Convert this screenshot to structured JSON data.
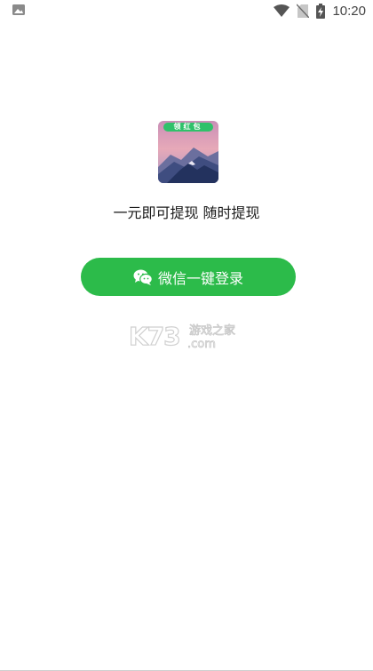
{
  "status_bar": {
    "time": "10:20"
  },
  "app": {
    "icon_caption": "领红包"
  },
  "tagline": "一元即可提现  随时提现",
  "login": {
    "label": "微信一键登录"
  },
  "watermark": {
    "brand": "K73",
    "site": "游戏之家",
    "domain": ".com"
  },
  "colors": {
    "accent": "#2cbb4a"
  }
}
